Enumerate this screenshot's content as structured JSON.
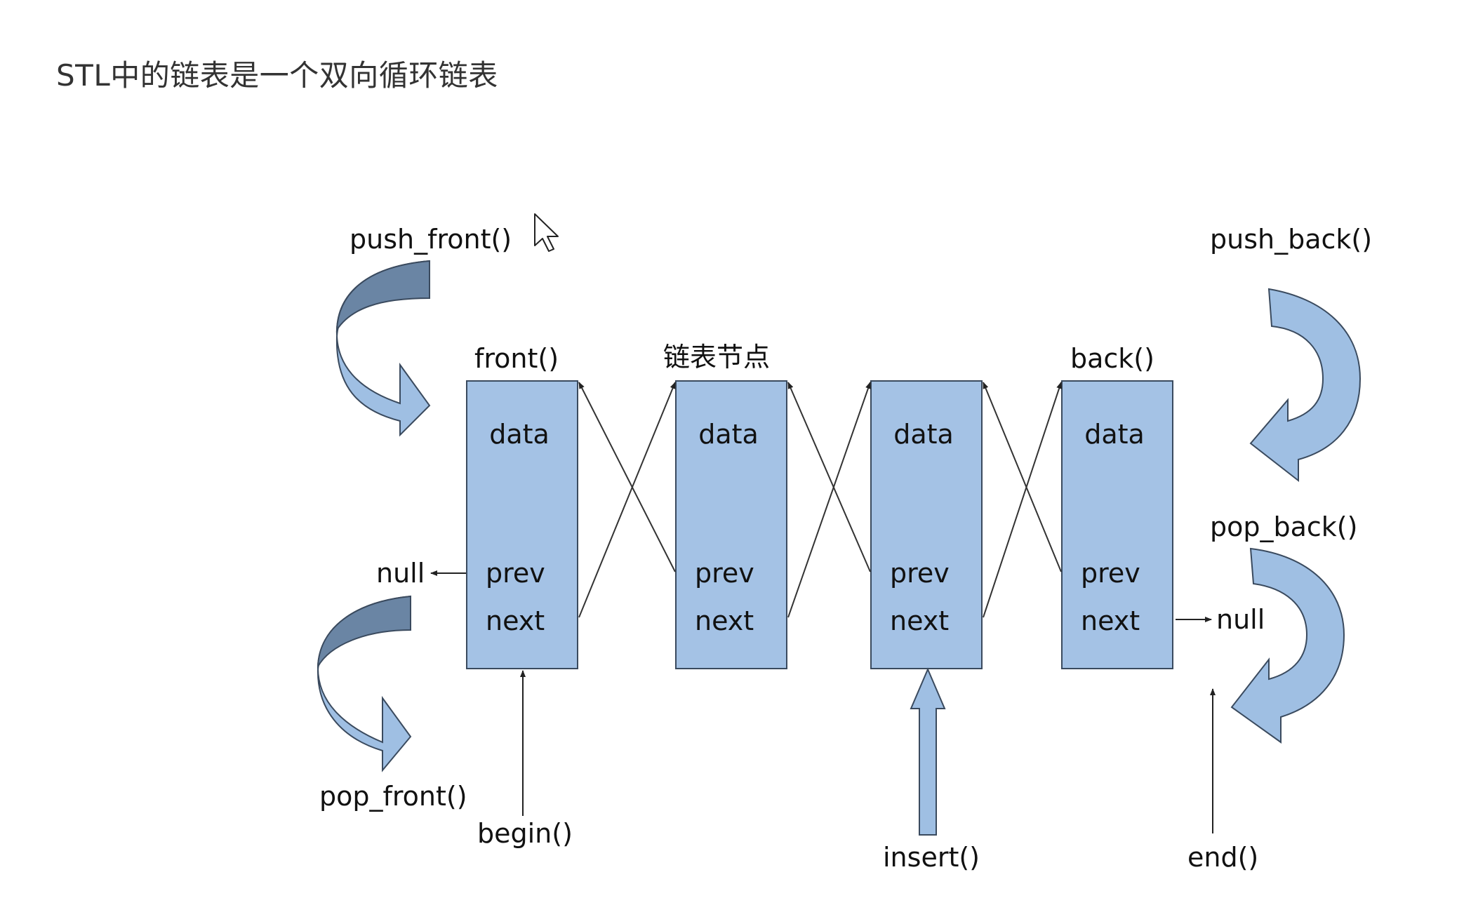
{
  "title": "STL中的链表是一个双向循环链表",
  "colors": {
    "node_fill": "#a4c2e5",
    "node_stroke": "#3a4a5e",
    "arrow_fill": "#9fbfe3",
    "arrow_shade": "#6a85a4",
    "line": "#333333"
  },
  "node_label": "链表节点",
  "nodes": [
    {
      "data": "data",
      "prev": "prev",
      "next": "next"
    },
    {
      "data": "data",
      "prev": "prev",
      "next": "next"
    },
    {
      "data": "data",
      "prev": "prev",
      "next": "next"
    },
    {
      "data": "data",
      "prev": "prev",
      "next": "next"
    }
  ],
  "labels": {
    "push_front": "push_front()",
    "pop_front": "pop_front()",
    "push_back": "push_back()",
    "pop_back": "pop_back()",
    "front": "front()",
    "back": "back()",
    "null_left": "null",
    "null_right": "null",
    "begin": "begin()",
    "end": "end()",
    "insert": "insert()"
  },
  "icons": {
    "cursor": "mouse-pointer-icon"
  }
}
